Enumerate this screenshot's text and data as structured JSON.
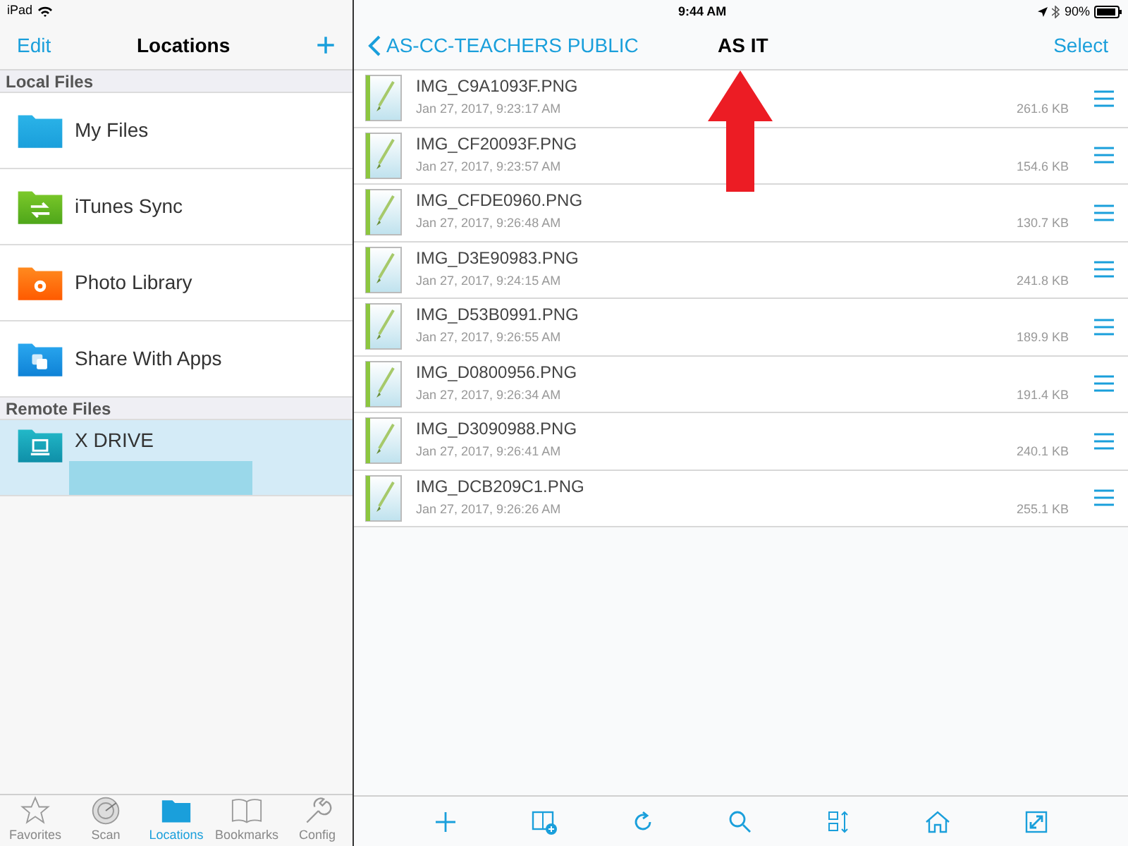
{
  "status_bar": {
    "device": "iPad",
    "time": "9:44 AM",
    "battery": "90%"
  },
  "left_nav": {
    "edit": "Edit",
    "title": "Locations",
    "add": "+"
  },
  "sections": [
    {
      "title": "Local Files",
      "items": [
        {
          "label": "My Files",
          "kind": "folder",
          "selected": false
        },
        {
          "label": "iTunes Sync",
          "kind": "sync",
          "selected": false
        },
        {
          "label": "Photo Library",
          "kind": "photos",
          "selected": false
        },
        {
          "label": "Share With Apps",
          "kind": "share",
          "selected": false
        }
      ]
    },
    {
      "title": "Remote Files",
      "items": [
        {
          "label": "X DRIVE",
          "kind": "remote",
          "selected": true,
          "redacted": true
        }
      ]
    }
  ],
  "tab_bar": [
    {
      "label": "Favorites",
      "kind": "star",
      "selected": false
    },
    {
      "label": "Scan",
      "kind": "radar",
      "selected": false
    },
    {
      "label": "Locations",
      "kind": "folder",
      "selected": true
    },
    {
      "label": "Bookmarks",
      "kind": "book",
      "selected": false
    },
    {
      "label": "Config",
      "kind": "wrench",
      "selected": false
    }
  ],
  "right_nav": {
    "back": "AS-CC-TEACHERS PUBLIC",
    "title": "AS IT",
    "select": "Select"
  },
  "files": [
    {
      "name": "IMG_C9A1093F.PNG",
      "date": "Jan 27, 2017, 9:23:17 AM",
      "size": "261.6 KB"
    },
    {
      "name": "IMG_CF20093F.PNG",
      "date": "Jan 27, 2017, 9:23:57 AM",
      "size": "154.6 KB"
    },
    {
      "name": "IMG_CFDE0960.PNG",
      "date": "Jan 27, 2017, 9:26:48 AM",
      "size": "130.7 KB"
    },
    {
      "name": "IMG_D3E90983.PNG",
      "date": "Jan 27, 2017, 9:24:15 AM",
      "size": "241.8 KB"
    },
    {
      "name": "IMG_D53B0991.PNG",
      "date": "Jan 27, 2017, 9:26:55 AM",
      "size": "189.9 KB"
    },
    {
      "name": "IMG_D0800956.PNG",
      "date": "Jan 27, 2017, 9:26:34 AM",
      "size": "191.4 KB"
    },
    {
      "name": "IMG_D3090988.PNG",
      "date": "Jan 27, 2017, 9:26:41 AM",
      "size": "240.1 KB"
    },
    {
      "name": "IMG_DCB209C1.PNG",
      "date": "Jan 27, 2017, 9:26:26 AM",
      "size": "255.1 KB"
    }
  ],
  "toolbar": [
    {
      "kind": "add"
    },
    {
      "kind": "book-add"
    },
    {
      "kind": "refresh"
    },
    {
      "kind": "search"
    },
    {
      "kind": "sort"
    },
    {
      "kind": "home"
    },
    {
      "kind": "expand"
    }
  ],
  "annotation": {
    "kind": "up-arrow"
  }
}
